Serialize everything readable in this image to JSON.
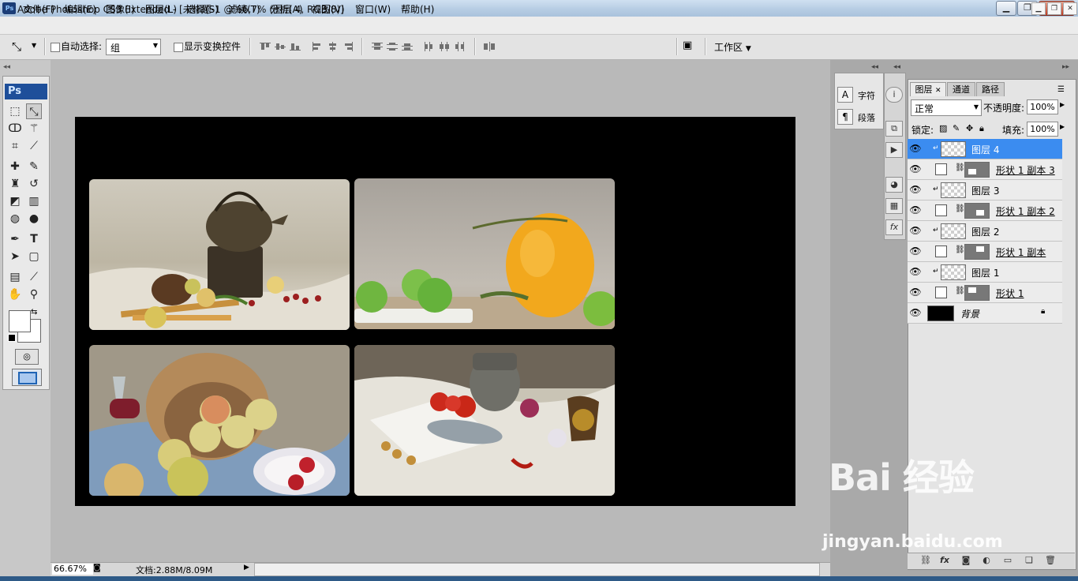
{
  "window": {
    "title": "Adobe Photoshop CS3 Extended - [未标题-1 @ 66.7% (图层 4, RGB/8)]",
    "app_icon": "Ps",
    "controls": [
      "minimize-icon",
      "maximize-icon",
      "close-icon"
    ]
  },
  "menu": {
    "ps_icon": "Ps",
    "items": [
      "文件(F)",
      "编辑(E)",
      "图像(I)",
      "图层(L)",
      "选择(S)",
      "滤镜(T)",
      "分析(A)",
      "视图(V)",
      "窗口(W)",
      "帮助(H)"
    ],
    "doc_controls": [
      "restore-icon",
      "maximize-icon",
      "close-icon"
    ]
  },
  "options": {
    "tool_icon": "move-tool-icon",
    "auto_select_label": "自动选择:",
    "auto_select_value": "组",
    "show_transform_label": "显示变换控件",
    "workspace_label": "工作区",
    "workspace_arrow": "▼"
  },
  "toolbox": {
    "logo": "Ps",
    "tools": [
      "marquee-icon",
      "move-icon",
      "lasso-icon",
      "magic-wand-icon",
      "crop-icon",
      "slice-icon",
      "healing-brush-icon",
      "brush-icon",
      "clone-stamp-icon",
      "history-brush-icon",
      "eraser-icon",
      "gradient-icon",
      "blur-icon",
      "dodge-icon",
      "pen-icon",
      "type-icon",
      "path-selection-icon",
      "shape-icon",
      "notes-icon",
      "eyedropper-icon",
      "hand-icon",
      "zoom-icon"
    ],
    "type_tool_glyph": "T"
  },
  "status": {
    "zoom": "66.67%",
    "doc_info": "文档:2.88M/8.09M"
  },
  "side_panel": {
    "char_label": "字符",
    "para_label": "段落"
  },
  "layers": {
    "tabs": [
      "图层",
      "通道",
      "路径"
    ],
    "blend_mode": "正常",
    "opacity_label": "不透明度:",
    "opacity": "100%",
    "lock_label": "锁定:",
    "fill_label": "填充:",
    "fill": "100%",
    "rows": [
      {
        "name": "图层 4",
        "kind": "image",
        "selected": true
      },
      {
        "name": "形状 1 副本 3",
        "kind": "shape",
        "selected": false
      },
      {
        "name": "图层 3",
        "kind": "image",
        "selected": false
      },
      {
        "name": "形状 1 副本 2",
        "kind": "shape",
        "selected": false
      },
      {
        "name": "图层 2",
        "kind": "image",
        "selected": false
      },
      {
        "name": "形状 1 副本",
        "kind": "shape",
        "selected": false
      },
      {
        "name": "图层 1",
        "kind": "image",
        "selected": false
      },
      {
        "name": "形状 1",
        "kind": "shape",
        "selected": false
      },
      {
        "name": "背景",
        "kind": "background",
        "selected": false
      }
    ]
  },
  "watermark": {
    "logo_text": "Bai 经验",
    "url": "jingyan.baidu.com"
  },
  "colors": {
    "selected_layer": "#3b8cf0",
    "document_background": "#000000",
    "workspace": "#b9b9b9"
  }
}
